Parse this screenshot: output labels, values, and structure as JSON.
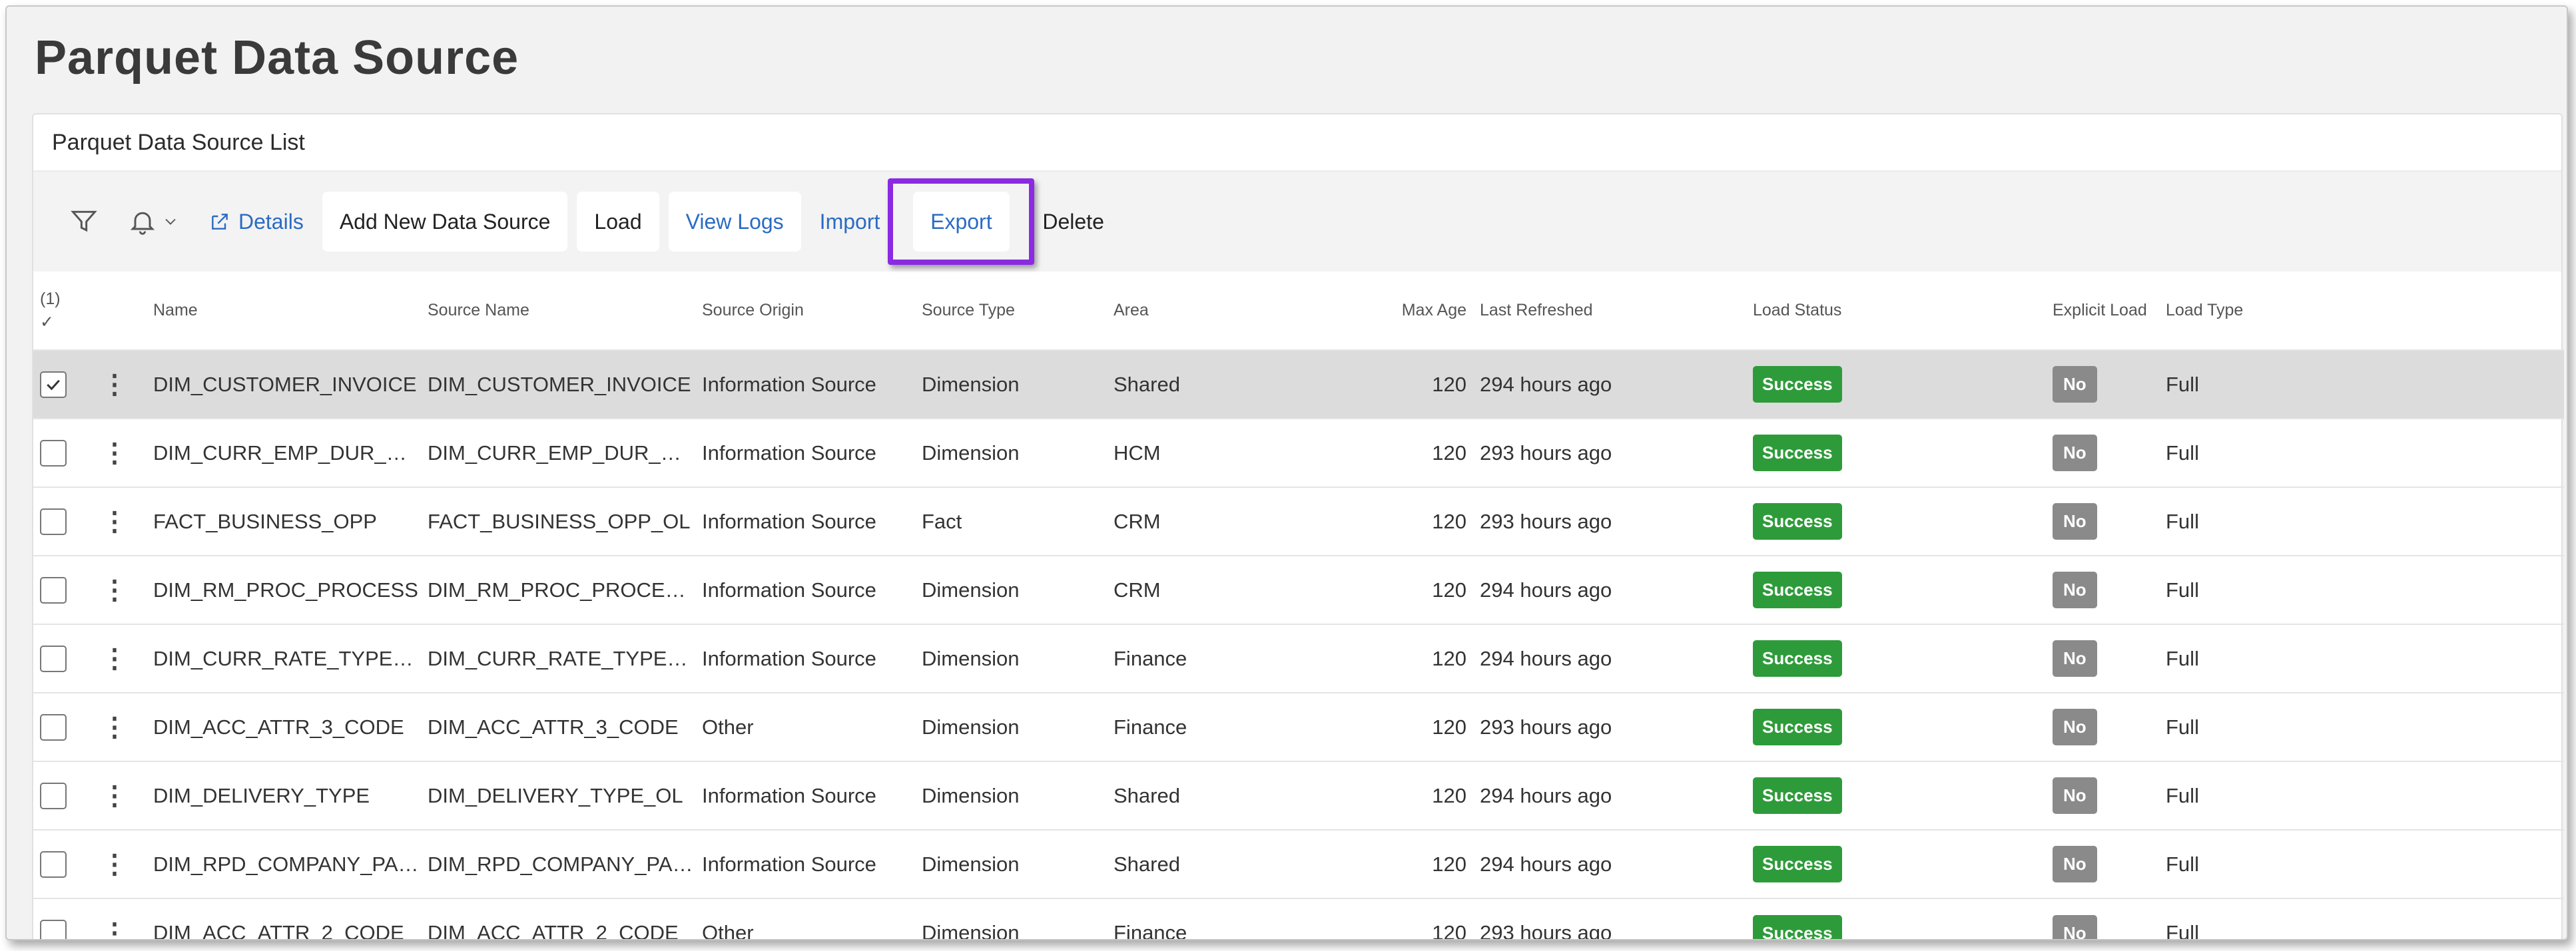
{
  "page": {
    "title": "Parquet Data Source"
  },
  "panel": {
    "title": "Parquet Data Source List"
  },
  "toolbar": {
    "filter_icon": "filter-icon",
    "bell_icon": "bell-icon",
    "details_label": "Details",
    "add_label": "Add New Data Source",
    "load_label": "Load",
    "view_logs_label": "View Logs",
    "import_label": "Import",
    "export_label": "Export",
    "delete_label": "Delete"
  },
  "table": {
    "selected_count": "(1)",
    "columns": {
      "name": "Name",
      "source_name": "Source Name",
      "source_origin": "Source Origin",
      "source_type": "Source Type",
      "area": "Area",
      "max_age": "Max Age",
      "last_refreshed": "Last Refreshed",
      "load_status": "Load Status",
      "explicit_load": "Explicit Load",
      "load_type": "Load Type"
    },
    "rows": [
      {
        "selected": true,
        "name": "DIM_CUSTOMER_INVOICE",
        "source_name": "DIM_CUSTOMER_INVOICE",
        "source_origin": "Information Source",
        "source_type": "Dimension",
        "area": "Shared",
        "max_age": "120",
        "last_refreshed": "294 hours ago",
        "load_status": "Success",
        "explicit_load": "No",
        "load_type": "Full"
      },
      {
        "selected": false,
        "name": "DIM_CURR_EMP_DUR_GROUP",
        "source_name": "DIM_CURR_EMP_DUR_GROUP",
        "source_origin": "Information Source",
        "source_type": "Dimension",
        "area": "HCM",
        "max_age": "120",
        "last_refreshed": "293 hours ago",
        "load_status": "Success",
        "explicit_load": "No",
        "load_type": "Full"
      },
      {
        "selected": false,
        "name": "FACT_BUSINESS_OPP",
        "source_name": "FACT_BUSINESS_OPP_OL",
        "source_origin": "Information Source",
        "source_type": "Fact",
        "area": "CRM",
        "max_age": "120",
        "last_refreshed": "293 hours ago",
        "load_status": "Success",
        "explicit_load": "No",
        "load_type": "Full"
      },
      {
        "selected": false,
        "name": "DIM_RM_PROC_PROCESS",
        "source_name": "DIM_RM_PROC_PROCESS_OL",
        "source_origin": "Information Source",
        "source_type": "Dimension",
        "area": "CRM",
        "max_age": "120",
        "last_refreshed": "294 hours ago",
        "load_status": "Success",
        "explicit_load": "No",
        "load_type": "Full"
      },
      {
        "selected": false,
        "name": "DIM_CURR_RATE_TYPE_OL",
        "source_name": "DIM_CURR_RATE_TYPE_OL",
        "source_origin": "Information Source",
        "source_type": "Dimension",
        "area": "Finance",
        "max_age": "120",
        "last_refreshed": "294 hours ago",
        "load_status": "Success",
        "explicit_load": "No",
        "load_type": "Full"
      },
      {
        "selected": false,
        "name": "DIM_ACC_ATTR_3_CODE",
        "source_name": "DIM_ACC_ATTR_3_CODE",
        "source_origin": "Other",
        "source_type": "Dimension",
        "area": "Finance",
        "max_age": "120",
        "last_refreshed": "293 hours ago",
        "load_status": "Success",
        "explicit_load": "No",
        "load_type": "Full"
      },
      {
        "selected": false,
        "name": "DIM_DELIVERY_TYPE",
        "source_name": "DIM_DELIVERY_TYPE_OL",
        "source_origin": "Information Source",
        "source_type": "Dimension",
        "area": "Shared",
        "max_age": "120",
        "last_refreshed": "294 hours ago",
        "load_status": "Success",
        "explicit_load": "No",
        "load_type": "Full"
      },
      {
        "selected": false,
        "name": "DIM_RPD_COMPANY_PARENT",
        "source_name": "DIM_RPD_COMPANY_PARENT",
        "source_origin": "Information Source",
        "source_type": "Dimension",
        "area": "Shared",
        "max_age": "120",
        "last_refreshed": "294 hours ago",
        "load_status": "Success",
        "explicit_load": "No",
        "load_type": "Full"
      },
      {
        "selected": false,
        "name": "DIM_ACC_ATTR_2_CODE",
        "source_name": "DIM_ACC_ATTR_2_CODE",
        "source_origin": "Other",
        "source_type": "Dimension",
        "area": "Finance",
        "max_age": "120",
        "last_refreshed": "293 hours ago",
        "load_status": "Success",
        "explicit_load": "No",
        "load_type": "Full"
      }
    ]
  },
  "colors": {
    "success": "#2e9b3a",
    "no_badge": "#8a8a8a",
    "link": "#2a6bc4",
    "highlight": "#8a2be2"
  }
}
